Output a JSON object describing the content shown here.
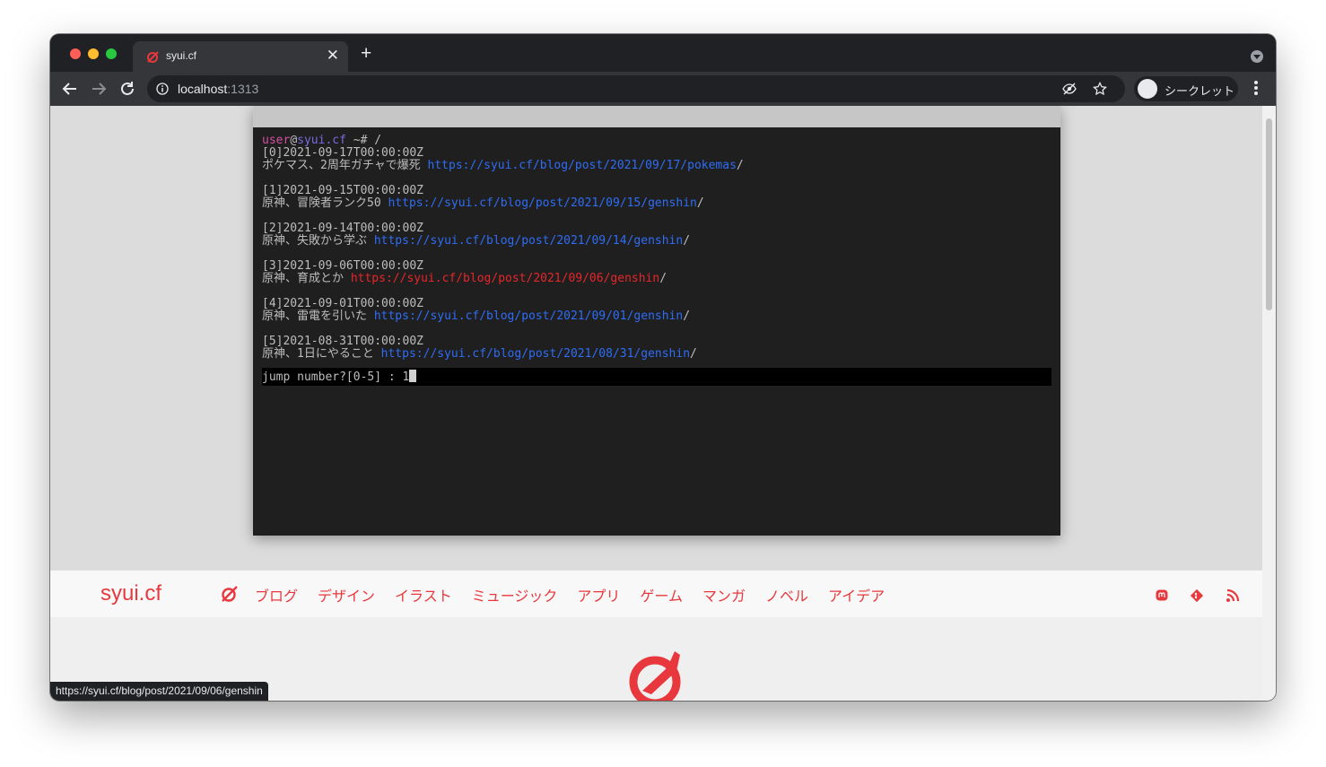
{
  "browser": {
    "tab": {
      "title": "syui.cf",
      "favicon": "syui-logo-icon",
      "close_icon": "close-icon"
    },
    "new_tab_icon": "plus-icon",
    "url": {
      "host": "localhost",
      "port": ":1313"
    },
    "incognito_label": "シークレット",
    "status_url": "https://syui.cf/blog/post/2021/09/06/genshin"
  },
  "terminal": {
    "prompt": {
      "user": "user",
      "at": "@",
      "host": "syui.cf",
      "rest": " ~# /"
    },
    "entries": [
      {
        "date": "[0]2021-09-17T00:00:00Z",
        "title": "ポケマス、2周年ガチャで爆死 ",
        "link": "https://syui.cf/blog/post/2021/09/17/pokemas",
        "slash": "/"
      },
      {
        "date": "[1]2021-09-15T00:00:00Z",
        "title": "原神、冒険者ランク50 ",
        "link": "https://syui.cf/blog/post/2021/09/15/genshin",
        "slash": "/"
      },
      {
        "date": "[2]2021-09-14T00:00:00Z",
        "title": "原神、失敗から学ぶ ",
        "link": "https://syui.cf/blog/post/2021/09/14/genshin",
        "slash": "/"
      },
      {
        "date": "[3]2021-09-06T00:00:00Z",
        "title": "原神、育成とか ",
        "link": "https://syui.cf/blog/post/2021/09/06/genshin",
        "slash": "/"
      },
      {
        "date": "[4]2021-09-01T00:00:00Z",
        "title": "原神、雷電を引いた ",
        "link": "https://syui.cf/blog/post/2021/09/01/genshin",
        "slash": "/"
      },
      {
        "date": "[5]2021-08-31T00:00:00Z",
        "title": "原神、1日にやること ",
        "link": "https://syui.cf/blog/post/2021/08/31/genshin",
        "slash": "/"
      }
    ],
    "hovered_index": 3,
    "jump_prompt": "jump number?[0-5] : ",
    "jump_value": "1"
  },
  "site": {
    "brand": "syui.cf",
    "nav": [
      "ブログ",
      "デザイン",
      "イラスト",
      "ミュージック",
      "アプリ",
      "ゲーム",
      "マンガ",
      "ノベル",
      "アイデア"
    ],
    "social_icons": [
      "mastodon-icon",
      "git-icon",
      "rss-icon"
    ]
  },
  "colors": {
    "accent": "#e8383d",
    "link": "#2f6df5",
    "link_hover": "#e8262a",
    "terminal_bg": "#1f1f1f"
  }
}
